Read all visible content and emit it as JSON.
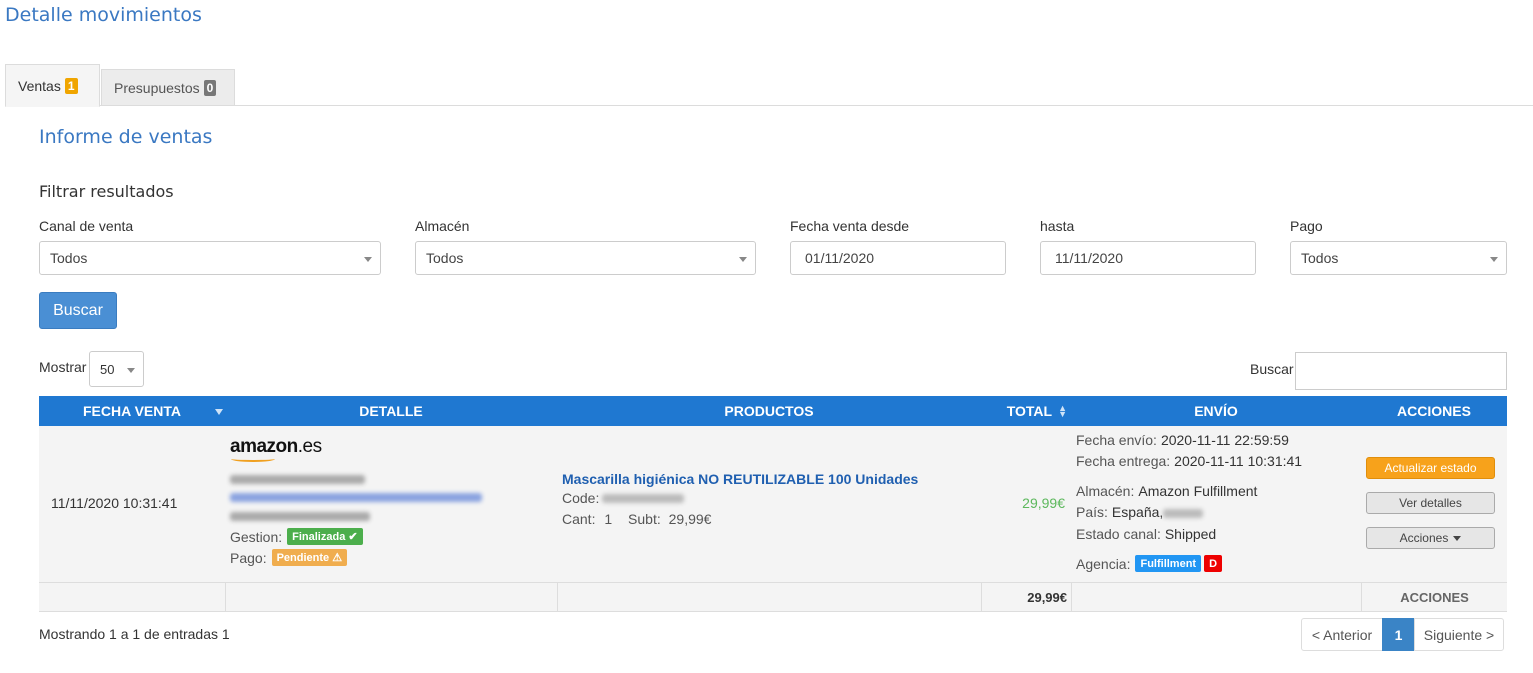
{
  "page_title": "Detalle movimientos",
  "tabs": [
    {
      "label": "Ventas",
      "count": "1"
    },
    {
      "label": "Presupuestos",
      "count": "0"
    }
  ],
  "section_title": "Informe de ventas",
  "filter": {
    "title": "Filtrar resultados",
    "canal_label": "Canal de venta",
    "canal_value": "Todos",
    "almacen_label": "Almacén",
    "almacen_value": "Todos",
    "fecha_desde_label": "Fecha venta desde",
    "fecha_desde_value": "01/11/2020",
    "hasta_label": "hasta",
    "hasta_value": "11/11/2020",
    "pago_label": "Pago",
    "pago_value": "Todos",
    "buscar_button": "Buscar"
  },
  "table_controls": {
    "mostrar_label": "Mostrar",
    "mostrar_value": "50",
    "buscar_label": "Buscar"
  },
  "table": {
    "headers": [
      "FECHA VENTA",
      "DETALLE",
      "PRODUCTOS",
      "TOTAL",
      "ENVÍO",
      "ACCIONES"
    ],
    "row": {
      "fecha": "11/11/2020 10:31:41",
      "logo": "amazon",
      "logo_suffix": ".es",
      "gestion_label": "Gestion:",
      "gestion_badge": "Finalizada ✔",
      "pago_label": "Pago:",
      "pago_badge": "Pendiente ⚠",
      "product_name": "Mascarilla higiénica NO REUTILIZABLE 100 Unidades",
      "code_label": "Code:",
      "cant_label": "Cant:",
      "cant_value": "1",
      "subt_label": "Subt:",
      "subt_value": "29,99€",
      "total": "29,99€",
      "fecha_envio_label": "Fecha envío:",
      "fecha_envio": "2020-11-11 22:59:59",
      "fecha_entrega_label": "Fecha entrega:",
      "fecha_entrega": "2020-11-11 10:31:41",
      "almacen_label": "Almacén:",
      "almacen": "Amazon Fulfillment",
      "pais_label": "País:",
      "pais": "España,",
      "estado_label": "Estado canal:",
      "estado": "Shipped",
      "agencia_label": "Agencia:",
      "agencia_badge": "Fulfillment",
      "agencia_d": "D",
      "btn_actualizar": "Actualizar estado",
      "btn_detalles": "Ver detalles",
      "btn_acciones": "Acciones"
    },
    "footer": {
      "total": "29,99€",
      "acciones": "ACCIONES"
    }
  },
  "pagination": {
    "info": "Mostrando 1 a 1 de entradas 1",
    "prev": "< Anterior",
    "current": "1",
    "next": "Siguiente >"
  },
  "colors": {
    "header_blue": "#1f78d1",
    "title_blue": "#3a78c2",
    "finalizada_green": "#4cae4c",
    "pendiente_orange": "#f0ad4e",
    "fulfillment_blue": "#2196f3",
    "total_green": "#5cb85c"
  }
}
